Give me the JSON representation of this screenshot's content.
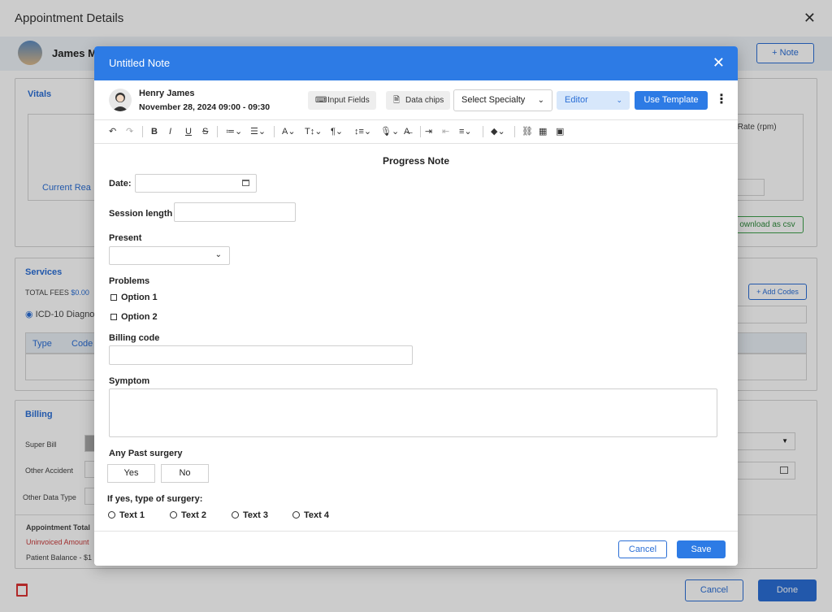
{
  "background": {
    "title": "Appointment Details",
    "patient_name": "James Ma",
    "note_button": "+ Note",
    "vitals": {
      "title": "Vitals",
      "current_reading": "Current Rea",
      "rate_header": "y Rate (rpm)",
      "download_csv": "ownload as csv"
    },
    "services": {
      "title": "Services",
      "total_fees_label": "TOTAL FEES",
      "total_fees_value": "$0.00",
      "icd_label": "ICD-10 Diagno",
      "add_codes": "+ Add Codes",
      "col_type": "Type",
      "col_code": "Code"
    },
    "billing": {
      "title": "Billing",
      "super_bill": "Super Bill",
      "other_accident": "Other Accident",
      "other_data_type": "Other Data Type",
      "appointment_total": "Appointment Total",
      "uninvoiced_amount": "Uninvoiced Amount",
      "patient_balance": "Patient Balance - $1"
    },
    "cancel": "Cancel",
    "done": "Done"
  },
  "modal": {
    "title": "Untitled Note",
    "provider_name": "Henry James",
    "appointment_time": "November 28, 2024 09:00 - 09:30",
    "input_fields": "Input Fields",
    "data_chips": "Data chips",
    "select_specialty": "Select Specialty",
    "editor": "Editor",
    "use_template": "Use Template",
    "toolbar": {
      "undo": "↶",
      "redo": "↷",
      "bold": "B",
      "italic": "I",
      "underline": "U",
      "strike": "S",
      "list": "≔⌄",
      "ordered": "☰⌄",
      "font": "A⌄",
      "size": "T↕⌄",
      "para": "¶⌄",
      "lineheight": "↕≡⌄",
      "mic": "🎙⌄",
      "spell": "A̶",
      "indent": "⇥",
      "outdent": "⇤",
      "align": "≡⌄",
      "color": "◆⌄",
      "link": "⛓",
      "table": "▦",
      "image": "▣"
    },
    "document": {
      "title": "Progress Note",
      "date_label": "Date:",
      "session_label": "Session length",
      "present_label": "Present",
      "problems_label": "Problems",
      "option1": "Option 1",
      "option2": "Option 2",
      "billing_code_label": "Billing code",
      "symptom_label": "Symptom",
      "past_surgery_label": "Any Past surgery",
      "yes": "Yes",
      "no": "No",
      "if_yes_label": "If yes, type of surgery:",
      "text1": "Text 1",
      "text2": "Text 2",
      "text3": "Text 3",
      "text4": "Text 4"
    },
    "cancel": "Cancel",
    "save": "Save"
  }
}
